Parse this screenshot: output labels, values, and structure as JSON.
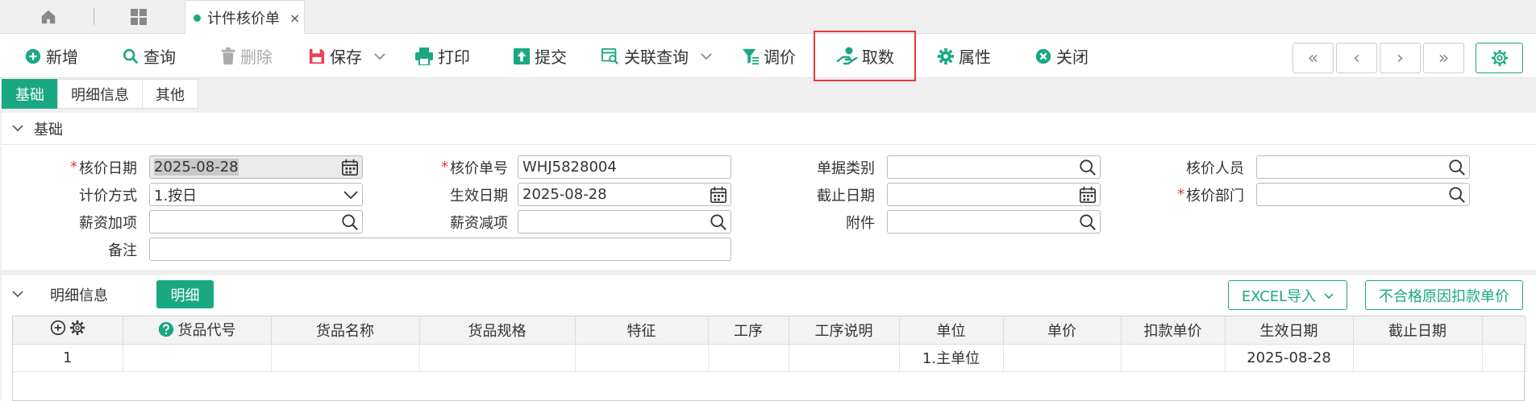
{
  "tabbar": {
    "doc_tab_label": "计件核价单",
    "close_glyph": "×"
  },
  "toolbar": {
    "new_label": "新增",
    "query_label": "查询",
    "delete_label": "删除",
    "save_label": "保存",
    "print_label": "打印",
    "submit_label": "提交",
    "related_query_label": "关联查询",
    "adjust_price_label": "调价",
    "fetch_label": "取数",
    "properties_label": "属性",
    "close_label": "关闭"
  },
  "nav": {
    "first": "«",
    "prev": "‹",
    "next": "›",
    "last": "»"
  },
  "subtabs": [
    "基础",
    "明细信息",
    "其他"
  ],
  "basic_section": {
    "title": "基础",
    "fields": {
      "price_date_label": "核价日期",
      "price_date_value": "2025-08-28",
      "price_no_label": "核价单号",
      "price_no_value": "WHJ5828004",
      "doc_type_label": "单据类别",
      "doc_type_value": "",
      "pricer_label": "核价人员",
      "pricer_value": "",
      "pricing_method_label": "计价方式",
      "pricing_method_value": "1.按日",
      "effective_date_label": "生效日期",
      "effective_date_value": "2025-08-28",
      "end_date_label": "截止日期",
      "end_date_value": "",
      "price_dept_label": "核价部门",
      "price_dept_value": "",
      "salary_add_label": "薪资加项",
      "salary_add_value": "",
      "salary_sub_label": "薪资减项",
      "salary_sub_value": "",
      "attachment_label": "附件",
      "attachment_value": "",
      "remark_label": "备注",
      "remark_value": "",
      "required_mark": "*"
    }
  },
  "detail_section": {
    "title": "明细信息",
    "detail_button": "明细",
    "excel_import_label": "EXCEL导入",
    "deduct_price_label": "不合格原因扣款单价",
    "columns": [
      "货品代号",
      "货品名称",
      "货品规格",
      "特征",
      "工序",
      "工序说明",
      "单位",
      "单价",
      "扣款单价",
      "生效日期",
      "截止日期"
    ],
    "rows": [
      {
        "index": "1",
        "cells": [
          "",
          "",
          "",
          "",
          "",
          "",
          "1.主单位",
          "",
          "",
          "2025-08-28",
          ""
        ]
      }
    ]
  },
  "colors": {
    "accent": "#1aa883",
    "highlight": "#e53935",
    "required": "#e53935"
  }
}
